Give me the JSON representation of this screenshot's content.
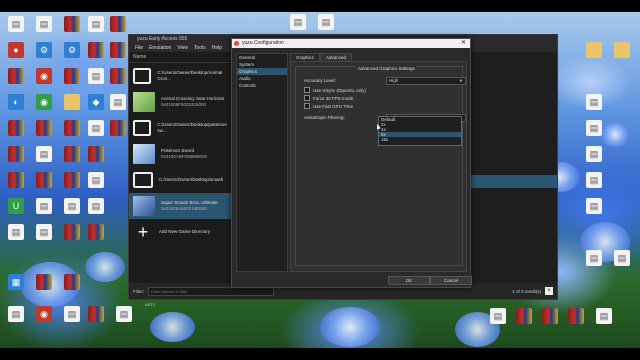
{
  "desktop_icons_left": [
    {
      "label": "",
      "kind": "doc",
      "glyph": ""
    },
    {
      "label": "",
      "kind": "doc",
      "glyph": "▤"
    },
    {
      "label": "",
      "kind": "rar",
      "glyph": ""
    },
    {
      "label": "",
      "kind": "red",
      "glyph": "●"
    },
    {
      "label": "",
      "kind": "blue",
      "glyph": "⚙"
    },
    {
      "label": "",
      "kind": "rar",
      "glyph": ""
    }
  ],
  "yuzu": {
    "title": "yuzu Early Access 955",
    "menu": [
      "File",
      "Emulation",
      "View",
      "Tools",
      "Help"
    ],
    "column_header": "Name",
    "rows": [
      {
        "type": "folder",
        "name": "C:/Users/Owner/Desktop/Animal Cros...",
        "sub": ""
      },
      {
        "type": "game",
        "name": "Animal Crossing: New Horizons",
        "sub": "0x01006F8002326000",
        "color": "#8fc37a"
      },
      {
        "type": "folder",
        "name": "C:/Users/Owner/Desktop/pokemon sw...",
        "sub": ""
      },
      {
        "type": "game",
        "name": "Pokémon Sword",
        "sub": "0x0100ABF008968000",
        "color": "#a6c8f0"
      },
      {
        "type": "folder",
        "name": "C:/Users/Owner/Desktop/smash",
        "sub": ""
      },
      {
        "type": "game",
        "name": "Super Smash Bros. Ultimate",
        "sub": "0x01006A800016E000",
        "color": "#6f9bd8",
        "selected": true
      },
      {
        "type": "add",
        "name": "Add New Game Directory",
        "sub": ""
      }
    ],
    "filter_label": "Filter:",
    "filter_placeholder": "Enter pattern to filter",
    "filter_count": "1 of 3 result(s)",
    "status_text": "ASTC"
  },
  "config": {
    "title": "yuzu Configuration",
    "nav": [
      "General",
      "System",
      "Graphics",
      "Audio",
      "Controls"
    ],
    "nav_active_index": 2,
    "tabs": [
      "Graphics",
      "Advanced"
    ],
    "active_tab": "Advanced",
    "group_title": "Advanced Graphics Settings",
    "accuracy_label": "Accuracy Level:",
    "accuracy_value": "High",
    "checkboxes": [
      {
        "label": "Use VSync (OpenGL only)",
        "checked": false
      },
      {
        "label": "Force 30 FPS mode",
        "checked": false
      },
      {
        "label": "Use Fast GPU Time",
        "checked": false
      }
    ],
    "aniso_label": "Anisotropic Filtering:",
    "aniso_value": "Default",
    "aniso_options": [
      "Default",
      "2x",
      "4x",
      "8x",
      "16x"
    ],
    "aniso_highlight_index": 3,
    "ok_label": "OK",
    "cancel_label": "Cancel"
  }
}
